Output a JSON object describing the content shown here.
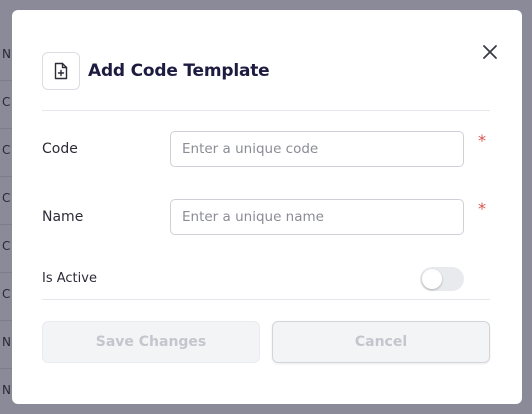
{
  "background_table": {
    "row_letters": [
      "N",
      "C",
      "C",
      "C",
      "C",
      "C",
      "N",
      "N"
    ]
  },
  "modal": {
    "title": "Add Code Template",
    "header_icon": "file-plus-icon",
    "close_icon": "close-icon",
    "fields": {
      "code": {
        "label": "Code",
        "value": "",
        "placeholder": "Enter a unique code",
        "required_mark": "*"
      },
      "name": {
        "label": "Name",
        "value": "",
        "placeholder": "Enter a unique name",
        "required_mark": "*"
      },
      "is_active": {
        "label": "Is Active",
        "value": false
      }
    },
    "buttons": {
      "save_label": "Save Changes",
      "cancel_label": "Cancel"
    }
  },
  "colors": {
    "backdrop": "#8a8a98",
    "title": "#1d1b40",
    "required": "#d9534f",
    "disabled_text": "#c4c6cd"
  }
}
